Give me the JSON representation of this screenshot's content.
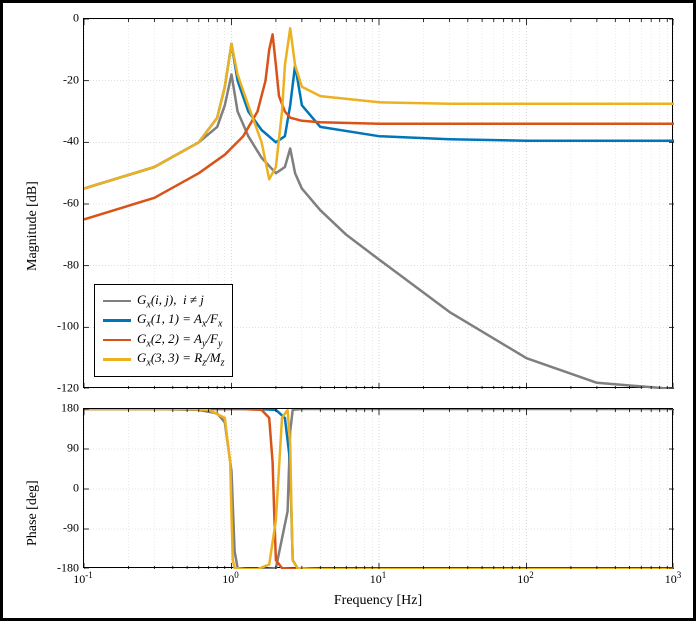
{
  "chart_data": [
    {
      "type": "line",
      "title": "",
      "xlabel": "",
      "ylabel": "Magnitude [dB]",
      "xlog": true,
      "xlim": [
        0.1,
        1000
      ],
      "ylim": [
        -120,
        0
      ],
      "yticks": [
        -120,
        -100,
        -80,
        -60,
        -40,
        -20,
        0
      ],
      "xticks": [
        0.1,
        1,
        10,
        100,
        1000
      ],
      "xticklabels": [
        "10⁻¹",
        "10⁰",
        "10¹",
        "10²",
        "10³"
      ],
      "series": [
        {
          "name": "Gx(i,j), i≠j",
          "color": "#7f7f7f",
          "x": [
            0.1,
            0.3,
            0.6,
            0.8,
            0.9,
            1.0,
            1.1,
            1.3,
            1.6,
            2.0,
            2.3,
            2.5,
            2.7,
            3.0,
            4.0,
            6.0,
            10,
            30,
            100,
            300,
            1000
          ],
          "y": [
            -55,
            -48,
            -40,
            -35,
            -28,
            -18,
            -30,
            -38,
            -45,
            -50,
            -48,
            -42,
            -50,
            -55,
            -62,
            -70,
            -78,
            -95,
            -110,
            -118,
            -120
          ]
        },
        {
          "name": "Gx(1,1) = Ax/Fx",
          "color": "#0076ba",
          "x": [
            0.1,
            0.3,
            0.6,
            0.8,
            0.9,
            1.0,
            1.1,
            1.3,
            1.6,
            2.0,
            2.3,
            2.5,
            2.7,
            3.0,
            4.0,
            10,
            30,
            100,
            1000
          ],
          "y": [
            -55,
            -48,
            -40,
            -32,
            -22,
            -8,
            -20,
            -30,
            -36,
            -40,
            -38,
            -28,
            -15,
            -28,
            -35,
            -38,
            -39,
            -39.5,
            -39.5
          ]
        },
        {
          "name": "Gx(2,2) = Ay/Fy",
          "color": "#d95319",
          "x": [
            0.1,
            0.3,
            0.6,
            0.9,
            1.2,
            1.5,
            1.7,
            1.8,
            1.9,
            2.0,
            2.1,
            2.3,
            2.5,
            3.0,
            4.0,
            10,
            30,
            100,
            1000
          ],
          "y": [
            -65,
            -58,
            -50,
            -44,
            -38,
            -30,
            -20,
            -10,
            -5,
            -15,
            -25,
            -30,
            -32,
            -33,
            -33.5,
            -34,
            -34,
            -34,
            -34
          ]
        },
        {
          "name": "Gx(3,3) = Rz/Mz",
          "color": "#edb120",
          "x": [
            0.1,
            0.3,
            0.6,
            0.8,
            0.9,
            1.0,
            1.1,
            1.3,
            1.6,
            1.8,
            2.0,
            2.2,
            2.3,
            2.5,
            2.7,
            3.0,
            4.0,
            10,
            30,
            100,
            1000
          ],
          "y": [
            -55,
            -48,
            -40,
            -32,
            -22,
            -8,
            -18,
            -28,
            -40,
            -52,
            -48,
            -30,
            -15,
            -3,
            -15,
            -22,
            -25,
            -27,
            -27.5,
            -27.5,
            -27.5
          ]
        }
      ],
      "legend": {
        "entries": [
          {
            "color": "#7f7f7f",
            "label_html": "<span class=\"legend-text\">G<span class=\"sub\">x</span>(i, j),&nbsp; i ≠ j</span>"
          },
          {
            "color": "#0076ba",
            "label_html": "<span class=\"legend-text\">G<span class=\"sub\">x</span>(1, 1) = A<span class=\"sub\">x</span>/F<span class=\"sub\">x</span></span>"
          },
          {
            "color": "#d95319",
            "label_html": "<span class=\"legend-text\">G<span class=\"sub\">x</span>(2, 2) = A<span class=\"sub\">y</span>/F<span class=\"sub\">y</span></span>"
          },
          {
            "color": "#edb120",
            "label_html": "<span class=\"legend-text\">G<span class=\"sub\">x</span>(3, 3) = R<span class=\"sub\">z</span>/M<span class=\"sub\">z</span></span>"
          }
        ]
      }
    },
    {
      "type": "line",
      "title": "",
      "xlabel": "Frequency [Hz]",
      "ylabel": "Phase [deg]",
      "xlog": true,
      "xlim": [
        0.1,
        1000
      ],
      "ylim": [
        -180,
        180
      ],
      "yticks": [
        -180,
        -90,
        0,
        90,
        180
      ],
      "xticks": [
        0.1,
        1,
        10,
        100,
        1000
      ],
      "xticklabels": [
        "10⁻¹",
        "10⁰",
        "10¹",
        "10²",
        "10³"
      ],
      "series": [
        {
          "name": "Gx(i,j), i≠j",
          "color": "#7f7f7f",
          "x": [
            0.1,
            0.3,
            0.6,
            0.8,
            0.9,
            1.0,
            1.05,
            1.1,
            1.3,
            1.7,
            2.0,
            2.4,
            2.5,
            2.6,
            3.0,
            10,
            1000
          ],
          "y": [
            180,
            180,
            178,
            170,
            150,
            40,
            -140,
            -178,
            -180,
            -180,
            -178,
            -50,
            130,
            178,
            180,
            180,
            180
          ]
        },
        {
          "name": "Gx(1,1) = Ax/Fx",
          "color": "#0076ba",
          "x": [
            0.1,
            0.5,
            1.5,
            2.0,
            2.3,
            2.5,
            2.55,
            2.6,
            2.8,
            3.5,
            10,
            1000
          ],
          "y": [
            180,
            180,
            180,
            178,
            160,
            60,
            -60,
            -160,
            -178,
            -180,
            -180,
            -180
          ]
        },
        {
          "name": "Gx(2,2) = Ay/Fy",
          "color": "#d95319",
          "x": [
            0.1,
            0.5,
            1.2,
            1.6,
            1.8,
            1.9,
            1.95,
            2.0,
            2.2,
            3.0,
            10,
            1000
          ],
          "y": [
            180,
            180,
            180,
            178,
            160,
            60,
            -60,
            -160,
            -178,
            -180,
            -180,
            -180
          ]
        },
        {
          "name": "Gx(3,3) = Rz/Mz",
          "color": "#edb120",
          "x": [
            0.1,
            0.5,
            0.7,
            0.9,
            0.98,
            1.0,
            1.02,
            1.05,
            1.2,
            1.5,
            1.8,
            2.0,
            2.2,
            2.4,
            2.5,
            2.55,
            2.6,
            2.8,
            4.0,
            10,
            1000
          ],
          "y": [
            180,
            180,
            178,
            160,
            60,
            -60,
            -160,
            -178,
            -180,
            -180,
            -170,
            -70,
            160,
            178,
            100,
            -50,
            -160,
            -178,
            -180,
            -180,
            -180
          ]
        }
      ]
    }
  ],
  "labels": {
    "mag_ylabel": "Magnitude [dB]",
    "phase_ylabel": "Phase [deg]",
    "xlabel": "Frequency [Hz]"
  },
  "legend_entries": [
    {
      "color": "#7f7f7f",
      "text": "Gx(i,j), i ≠ j"
    },
    {
      "color": "#0076ba",
      "text": "Gx(1,1) = Ax/Fx"
    },
    {
      "color": "#d95319",
      "text": "Gx(2,2) = Ay/Fy"
    },
    {
      "color": "#edb120",
      "text": "Gx(3,3) = Rz/Mz"
    }
  ]
}
